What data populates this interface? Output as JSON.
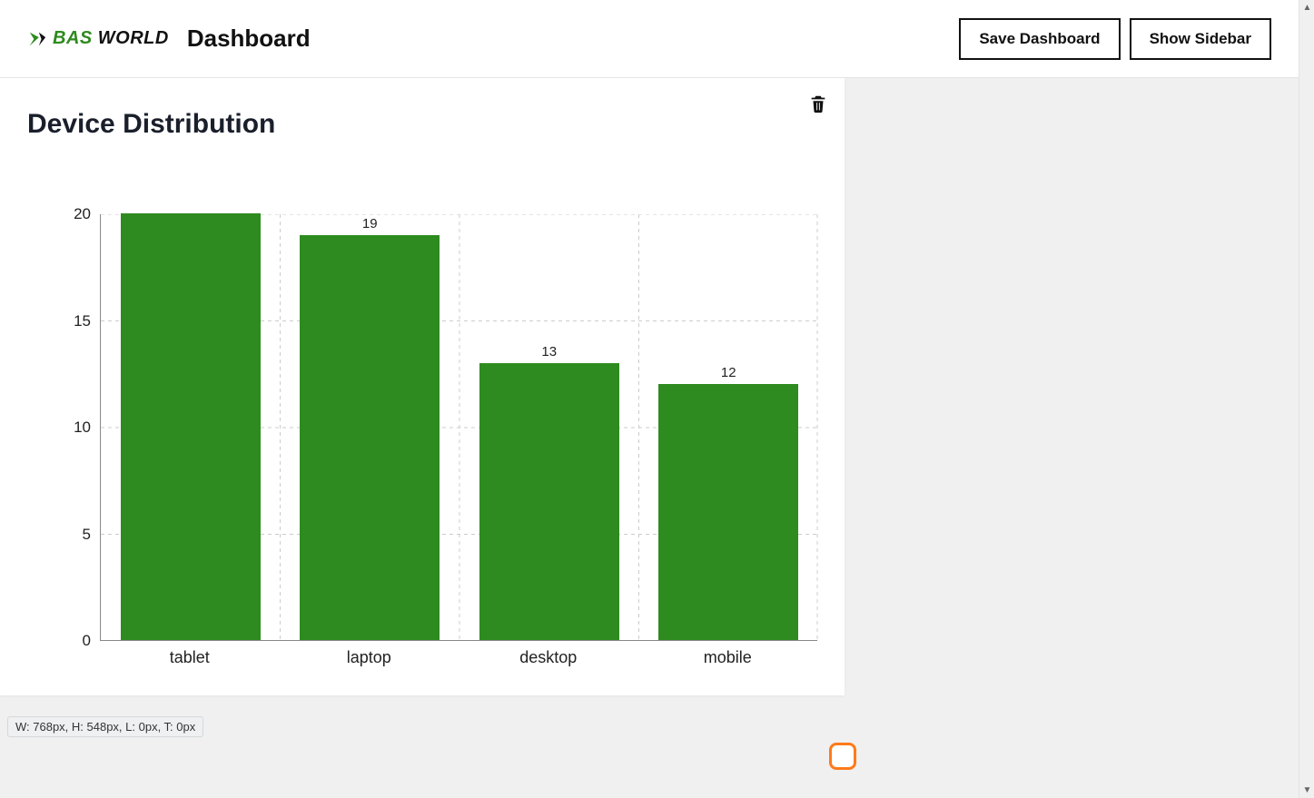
{
  "header": {
    "logo_bas": "BAS",
    "logo_world": " WORLD",
    "page_title": "Dashboard",
    "save_label": "Save Dashboard",
    "sidebar_label": "Show Sidebar"
  },
  "card": {
    "title": "Device Distribution",
    "size_info": "W: 768px, H: 548px, L: 0px, T: 0px"
  },
  "chart_data": {
    "type": "bar",
    "categories": [
      "tablet",
      "laptop",
      "desktop",
      "mobile"
    ],
    "values": [
      20,
      19,
      13,
      12
    ],
    "value_labels": [
      "",
      "19",
      "13",
      "12"
    ],
    "yticks": [
      0,
      5,
      10,
      15,
      20
    ],
    "ylim": [
      0,
      20
    ],
    "bar_color": "#2e8b1f",
    "title": "Device Distribution",
    "xlabel": "",
    "ylabel": ""
  }
}
